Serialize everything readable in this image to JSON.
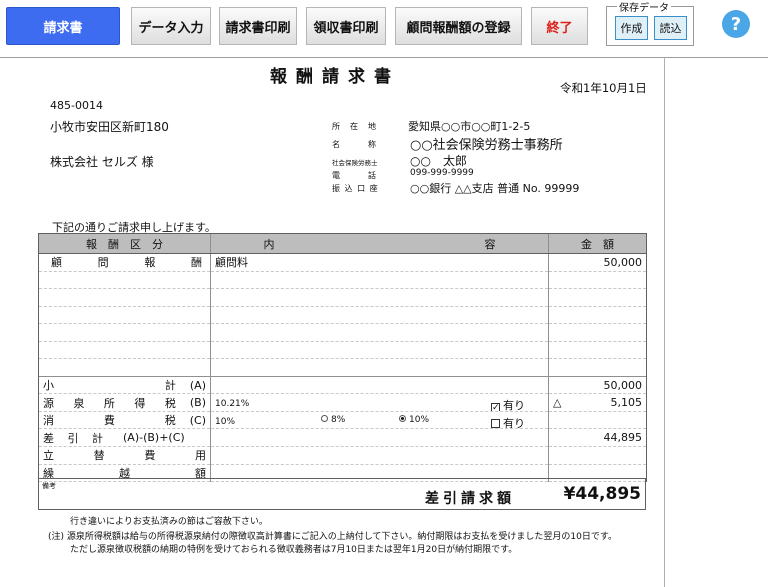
{
  "toolbar": {
    "invoice_tab": "請求書",
    "data_entry": "データ入力",
    "print_invoice": "請求書印刷",
    "print_receipt": "領収書印刷",
    "register_fee": "顧問報酬額の登録",
    "quit": "終了",
    "save_group": "保存データ",
    "create": "作成",
    "load": "読込",
    "help": "?"
  },
  "colors": {
    "primary": "#3d6cf0",
    "danger": "#e0201a",
    "help": "#4aa6e6",
    "header_bg": "#bdbdbd"
  },
  "invoice": {
    "title": "報酬請求書",
    "date": "令和1年10月1日",
    "recipient": {
      "postal": "485-0014",
      "address": "小牧市安田区新町180",
      "name": "株式会社 セルズ 様"
    },
    "issuer": {
      "address_label": "所　在　地",
      "address": "愛知県○○市○○町1-2-5",
      "name_label": "名　　　称",
      "name": "○○社会保険労務士事務所",
      "role_label": "社会保険労務士",
      "person": "○○　太郎",
      "phone_label": "電　　　話",
      "phone": "099-999-9999",
      "bank_label": "振 込 口 座",
      "bank": "○○銀行 △△支店 普通 No. 99999"
    },
    "intro": "下記の通りご請求申し上げます。",
    "headers": {
      "category": "報　酬　区　分",
      "content_a": "内",
      "content_b": "容",
      "amount": "金　額"
    },
    "rows": {
      "advisory": {
        "label": "顧問報酬",
        "content": "顧問料",
        "amount": "50,000"
      },
      "subtotal": {
        "label": "小計",
        "code": "(A)",
        "amount": "50,000"
      },
      "withholding": {
        "label": "源泉所得税",
        "code": "(B)",
        "rate": "10.21%",
        "yes_label": "有り",
        "sign": "△",
        "amount": "5,105"
      },
      "tax": {
        "label": "消費税",
        "code": "(C)",
        "rate": "10%",
        "opt8": "8%",
        "opt10": "10%",
        "yes_label": "有り"
      },
      "net": {
        "label": "差引計",
        "code": "(A)-(B)+(C)",
        "amount": "44,895"
      },
      "advance": {
        "label": "立替費用"
      },
      "carryover": {
        "label": "繰越額"
      }
    },
    "remarks_label": "備考",
    "total_label": "差引請求額",
    "total": "¥44,895",
    "note1": "行き違いによりお支払済みの節はご容赦下さい。",
    "note2": "(注) 源泉所得税額は給与の所得税源泉納付の際徴収高計算書にご記入の上納付して下さい。納付期限はお支払を受けました翌月の10日です。",
    "note3": "ただし源泉徴収税額の納期の特例を受けておられる徴収義務者は7月10日または翌年1月20日が納付期限です。"
  }
}
